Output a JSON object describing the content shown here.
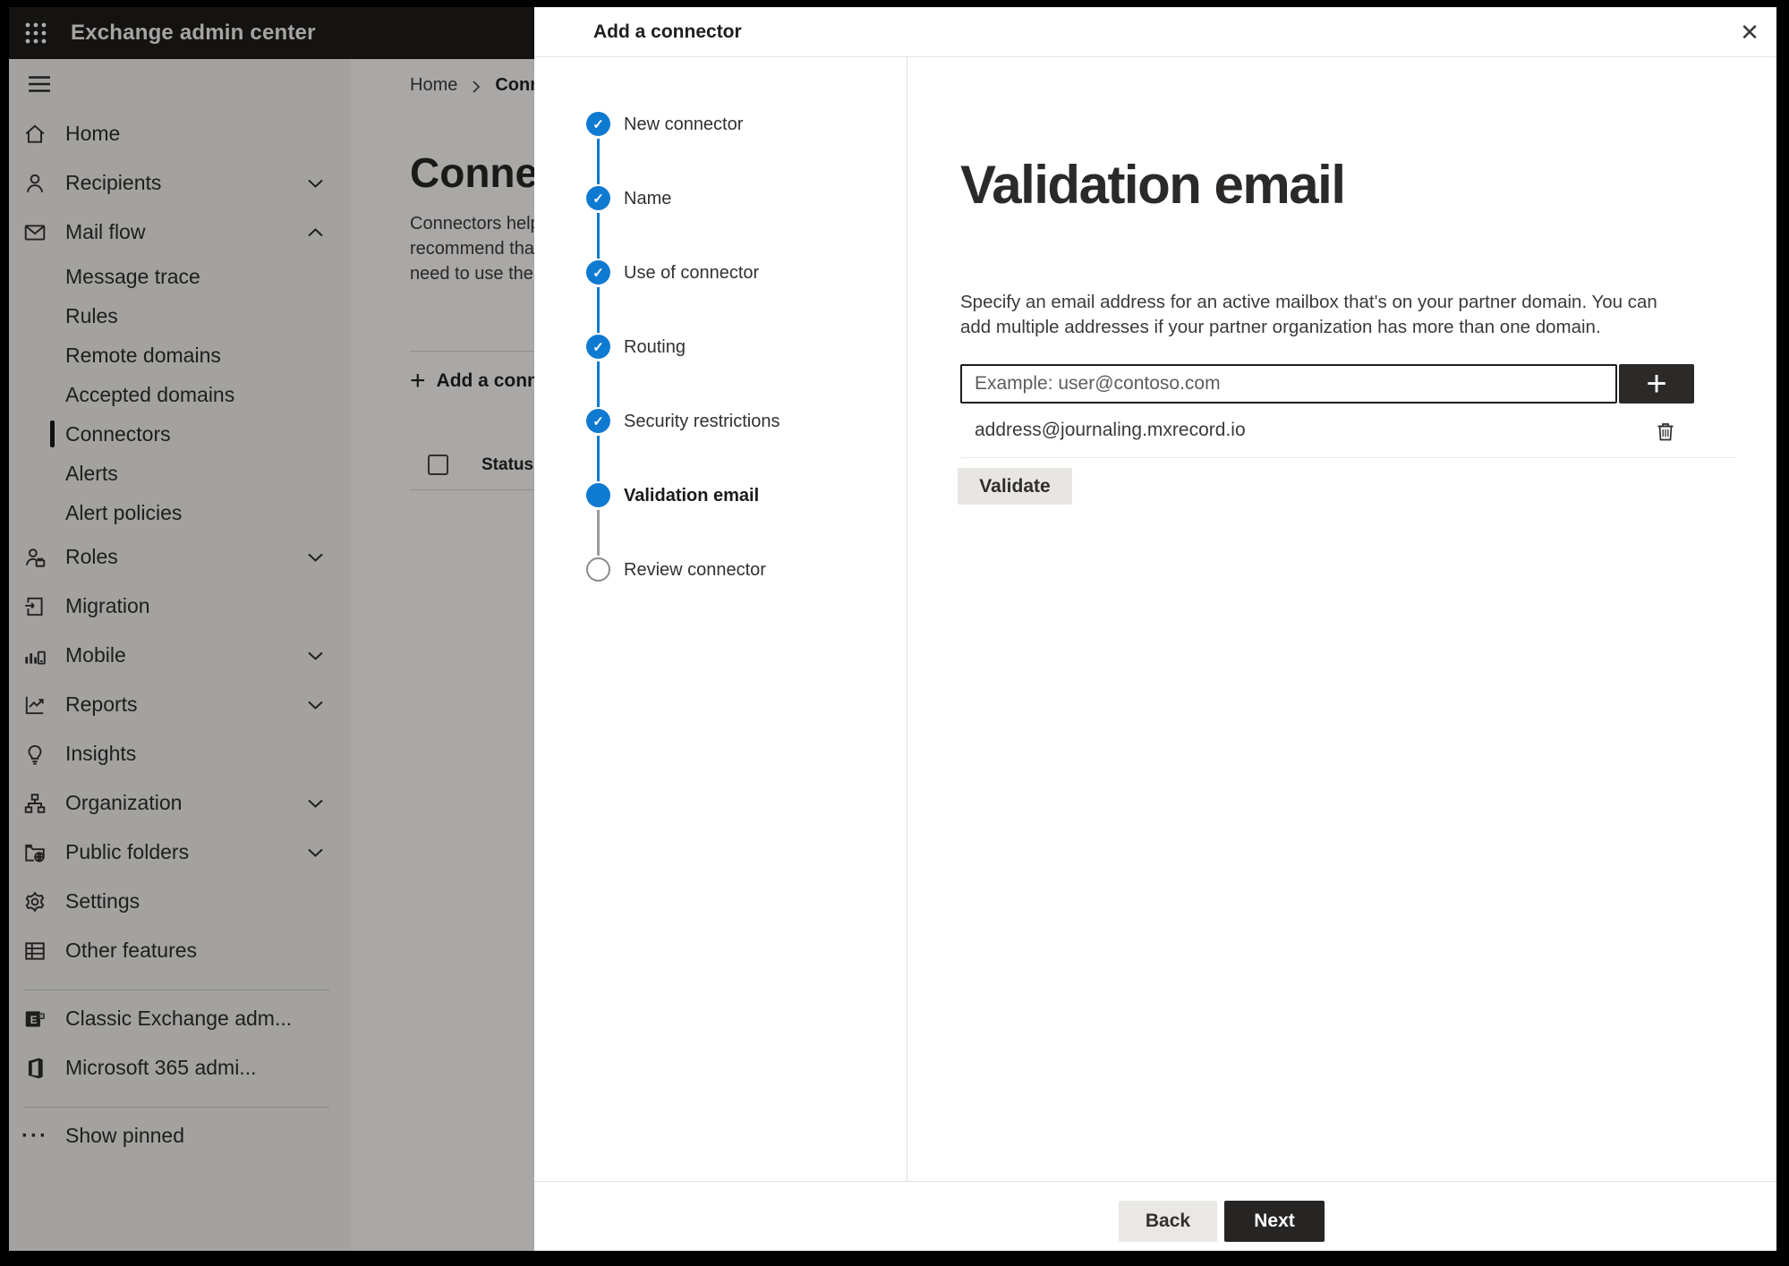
{
  "header": {
    "app_title": "Exchange admin center"
  },
  "icons": {
    "add_plus": "+",
    "close_x": "✕",
    "check": "✓",
    "ellipsis": "···"
  },
  "sidebar": {
    "items": [
      {
        "label": "Home",
        "icon": "home-icon",
        "chevron": null,
        "selected": false,
        "sub": false
      },
      {
        "label": "Recipients",
        "icon": "person-icon",
        "chevron": "down",
        "selected": false,
        "sub": false
      },
      {
        "label": "Mail flow",
        "icon": "mail-icon",
        "chevron": "up",
        "selected": false,
        "sub": false
      },
      {
        "label": "Message trace",
        "icon": null,
        "chevron": null,
        "selected": false,
        "sub": true
      },
      {
        "label": "Rules",
        "icon": null,
        "chevron": null,
        "selected": false,
        "sub": true
      },
      {
        "label": "Remote domains",
        "icon": null,
        "chevron": null,
        "selected": false,
        "sub": true
      },
      {
        "label": "Accepted domains",
        "icon": null,
        "chevron": null,
        "selected": false,
        "sub": true
      },
      {
        "label": "Connectors",
        "icon": null,
        "chevron": null,
        "selected": true,
        "sub": true
      },
      {
        "label": "Alerts",
        "icon": null,
        "chevron": null,
        "selected": false,
        "sub": true
      },
      {
        "label": "Alert policies",
        "icon": null,
        "chevron": null,
        "selected": false,
        "sub": true
      },
      {
        "label": "Roles",
        "icon": "roles-icon",
        "chevron": "down",
        "selected": false,
        "sub": false
      },
      {
        "label": "Migration",
        "icon": "migration-icon",
        "chevron": null,
        "selected": false,
        "sub": false
      },
      {
        "label": "Mobile",
        "icon": "mobile-icon",
        "chevron": "down",
        "selected": false,
        "sub": false
      },
      {
        "label": "Reports",
        "icon": "reports-icon",
        "chevron": "down",
        "selected": false,
        "sub": false
      },
      {
        "label": "Insights",
        "icon": "insights-icon",
        "chevron": null,
        "selected": false,
        "sub": false
      },
      {
        "label": "Organization",
        "icon": "organization-icon",
        "chevron": "down",
        "selected": false,
        "sub": false
      },
      {
        "label": "Public folders",
        "icon": "public-folders-icon",
        "chevron": "down",
        "selected": false,
        "sub": false
      },
      {
        "label": "Settings",
        "icon": "settings-icon",
        "chevron": null,
        "selected": false,
        "sub": false
      },
      {
        "label": "Other features",
        "icon": "other-features-icon",
        "chevron": null,
        "selected": false,
        "sub": false
      },
      {
        "label": "Classic Exchange adm...",
        "icon": "classic-exchange-icon",
        "chevron": null,
        "selected": false,
        "sub": false
      },
      {
        "label": "Microsoft 365 admi...",
        "icon": "microsoft-365-icon",
        "chevron": null,
        "selected": false,
        "sub": false
      },
      {
        "label": "Show pinned",
        "icon": "ellipsis-icon",
        "chevron": null,
        "selected": false,
        "sub": false
      }
    ]
  },
  "background_page": {
    "breadcrumb": {
      "home": "Home",
      "current": "Conne"
    },
    "heading": "Connec",
    "description_lines": [
      "Connectors help",
      "recommend tha",
      "need to use ther"
    ],
    "add_button_label": "Add a conn",
    "table": {
      "status_header": "Status"
    }
  },
  "panel": {
    "title": "Add a connector",
    "steps": [
      {
        "label": "New connector",
        "state": "complete"
      },
      {
        "label": "Name",
        "state": "complete"
      },
      {
        "label": "Use of connector",
        "state": "complete"
      },
      {
        "label": "Routing",
        "state": "complete"
      },
      {
        "label": "Security restrictions",
        "state": "complete"
      },
      {
        "label": "Validation email",
        "state": "current"
      },
      {
        "label": "Review connector",
        "state": "upcoming"
      }
    ],
    "content": {
      "heading": "Validation email",
      "description": "Specify an email address for an active mailbox that's on your partner domain. You can add multiple addresses if your partner organization has more than one domain.",
      "email_input": {
        "value": "",
        "placeholder": "Example: user@contoso.com"
      },
      "addresses": [
        {
          "email": "address@journaling.mxrecord.io"
        }
      ],
      "validate_button": "Validate"
    },
    "footer": {
      "back_button": "Back",
      "next_button": "Next"
    }
  },
  "colors": {
    "accent_blue": "#0f7ad1",
    "dark_button": "#262524",
    "header_bg": "#1b1a19",
    "panel_bg": "#ffffff"
  }
}
